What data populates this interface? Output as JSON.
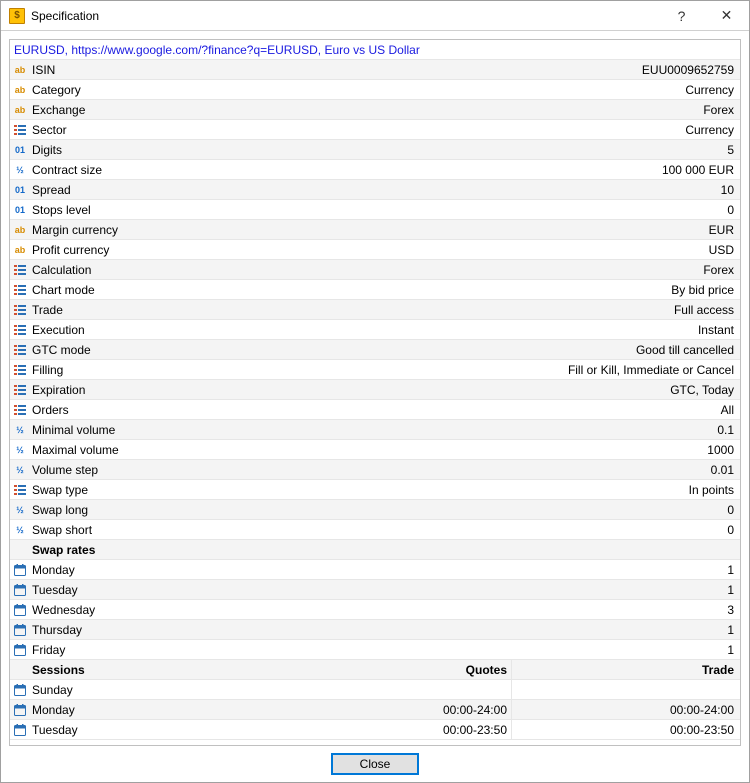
{
  "window": {
    "title": "Specification",
    "help": "?",
    "close": "✕"
  },
  "link_row": "EURUSD, https://www.google.com/?finance?q=EURUSD, Euro vs US Dollar",
  "rows": [
    {
      "icon": "ab",
      "label": "ISIN",
      "value": "EUU0009652759"
    },
    {
      "icon": "ab",
      "label": "Category",
      "value": "Currency"
    },
    {
      "icon": "ab",
      "label": "Exchange",
      "value": "Forex"
    },
    {
      "icon": "list",
      "label": "Sector",
      "value": "Currency"
    },
    {
      "icon": "01",
      "label": "Digits",
      "value": "5"
    },
    {
      "icon": "half",
      "label": "Contract size",
      "value": "100 000 EUR"
    },
    {
      "icon": "01",
      "label": "Spread",
      "value": "10"
    },
    {
      "icon": "01",
      "label": "Stops level",
      "value": "0"
    },
    {
      "icon": "ab",
      "label": "Margin currency",
      "value": "EUR"
    },
    {
      "icon": "ab",
      "label": "Profit currency",
      "value": "USD"
    },
    {
      "icon": "list",
      "label": "Calculation",
      "value": "Forex"
    },
    {
      "icon": "list",
      "label": "Chart mode",
      "value": "By bid price"
    },
    {
      "icon": "list",
      "label": "Trade",
      "value": "Full access"
    },
    {
      "icon": "list",
      "label": "Execution",
      "value": "Instant"
    },
    {
      "icon": "list",
      "label": "GTC mode",
      "value": "Good till cancelled"
    },
    {
      "icon": "list",
      "label": "Filling",
      "value": "Fill or Kill, Immediate or Cancel"
    },
    {
      "icon": "list",
      "label": "Expiration",
      "value": "GTC, Today"
    },
    {
      "icon": "list",
      "label": "Orders",
      "value": "All"
    },
    {
      "icon": "half",
      "label": "Minimal volume",
      "value": "0.1"
    },
    {
      "icon": "half",
      "label": "Maximal volume",
      "value": "1000"
    },
    {
      "icon": "half",
      "label": "Volume step",
      "value": "0.01"
    },
    {
      "icon": "list",
      "label": "Swap type",
      "value": "In points"
    },
    {
      "icon": "half",
      "label": "Swap long",
      "value": "0"
    },
    {
      "icon": "half",
      "label": "Swap short",
      "value": "0"
    }
  ],
  "swap_section": {
    "title": "Swap rates",
    "days": [
      {
        "label": "Monday",
        "value": "1"
      },
      {
        "label": "Tuesday",
        "value": "1"
      },
      {
        "label": "Wednesday",
        "value": "3"
      },
      {
        "label": "Thursday",
        "value": "1"
      },
      {
        "label": "Friday",
        "value": "1"
      }
    ]
  },
  "sessions": {
    "title": "Sessions",
    "quotes_label": "Quotes",
    "trade_label": "Trade",
    "days": [
      {
        "label": "Sunday",
        "quotes": "",
        "trade": ""
      },
      {
        "label": "Monday",
        "quotes": "00:00-24:00",
        "trade": "00:00-24:00"
      },
      {
        "label": "Tuesday",
        "quotes": "00:00-23:50",
        "trade": "00:00-23:50"
      }
    ]
  },
  "footer": {
    "close": "Close"
  }
}
